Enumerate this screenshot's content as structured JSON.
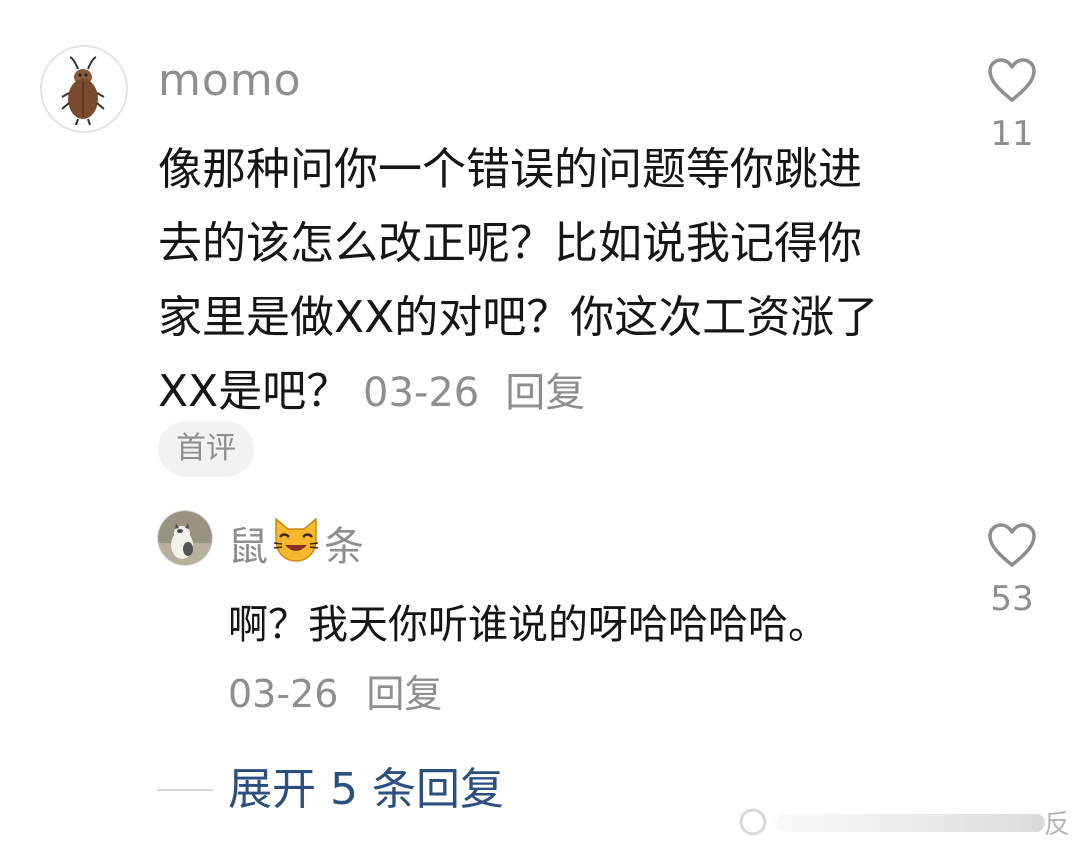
{
  "comment": {
    "username": "momo",
    "text": "像那种问你一个错误的问题等你跳进\n去的该怎么改正呢？比如说我记得你\n家里是做XX的对吧？你这次工资涨了\nXX是吧？",
    "date": "03-26",
    "reply_label": "回复",
    "badge": "首评",
    "like_count": "11"
  },
  "reply": {
    "username_left": "鼠",
    "username_emoji": "😺",
    "username_right": "条",
    "text": "啊？我天你听谁说的呀哈哈哈哈。",
    "date": "03-26",
    "reply_label": "回复",
    "like_count": "53"
  },
  "expand": {
    "label": "展开 5 条回复"
  },
  "watermark": {
    "text": "反"
  },
  "colors": {
    "text_primary": "#151515",
    "text_secondary": "#8e8e8e",
    "link": "#2a4f80",
    "badge_bg": "#f2f2f2"
  }
}
